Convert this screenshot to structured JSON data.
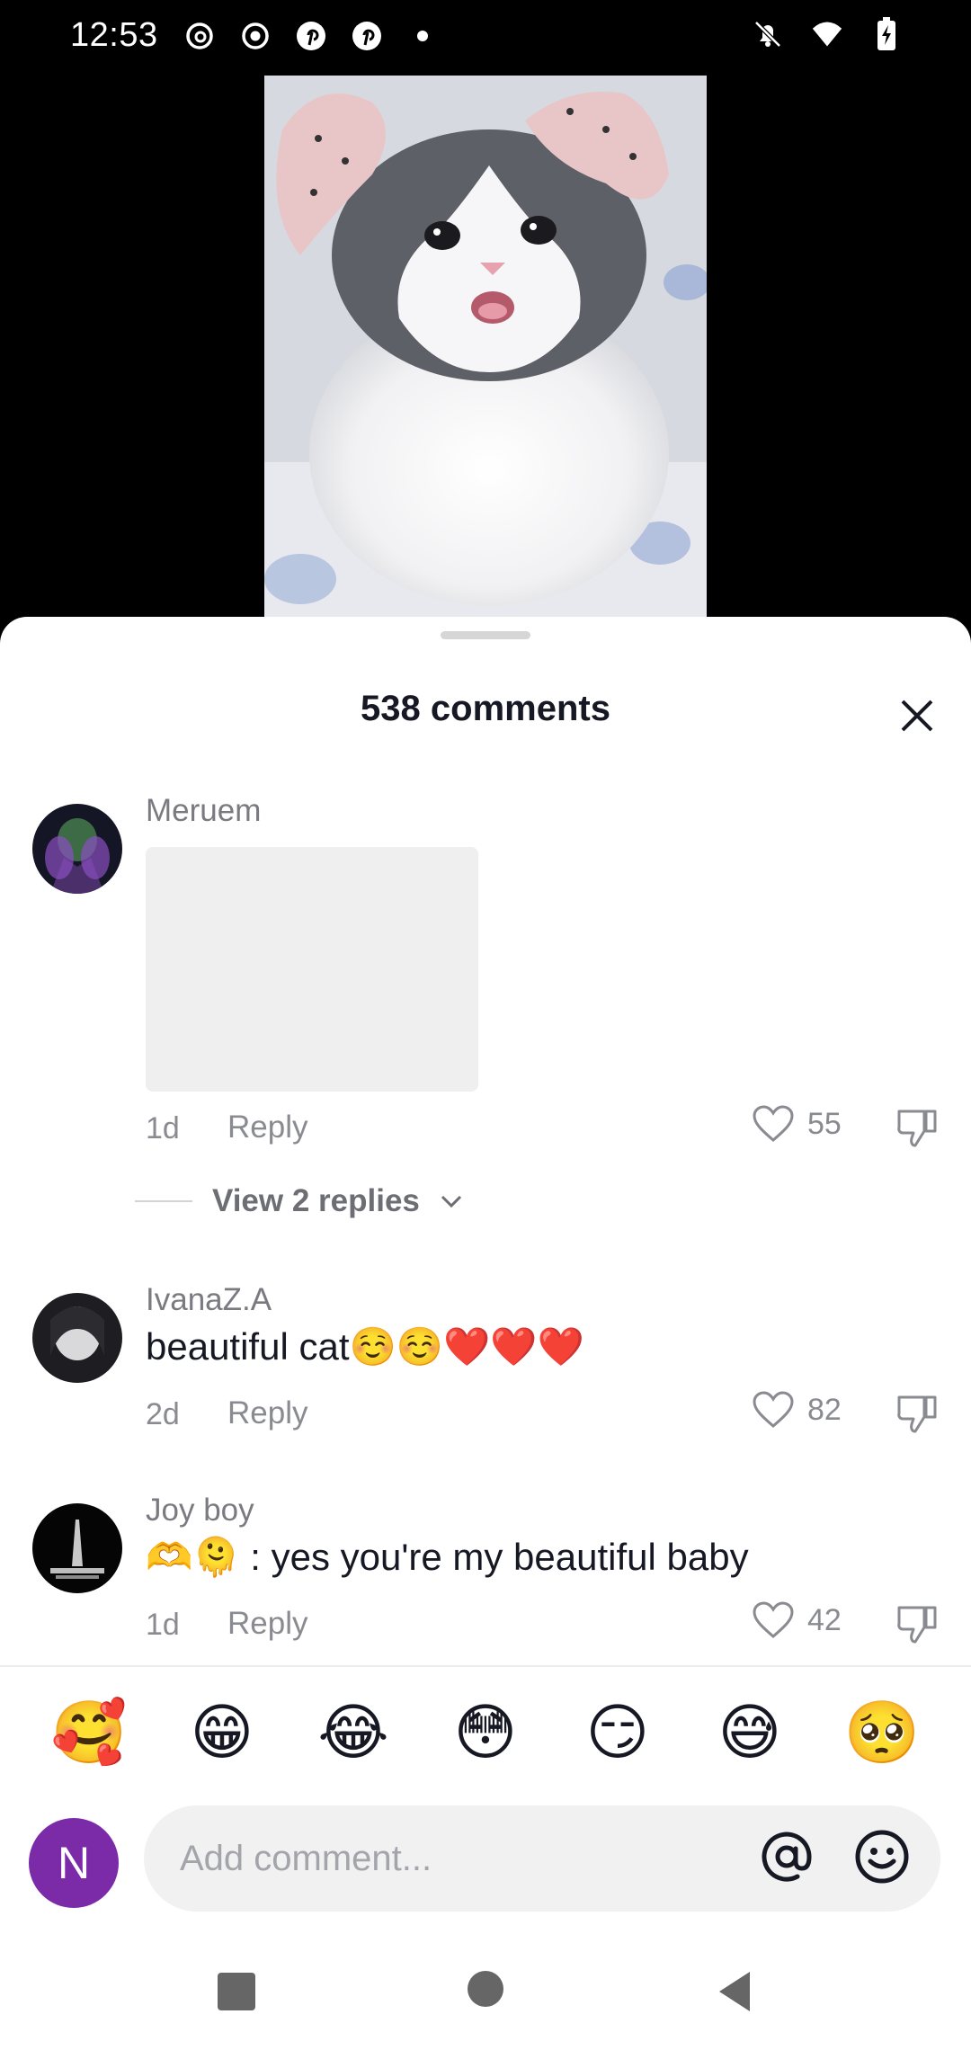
{
  "status_bar": {
    "time": "12:53",
    "left_icons": [
      "threads-icon",
      "record-icon",
      "pinterest-icon",
      "pinterest-icon",
      "dot-icon"
    ],
    "right_icons": [
      "bell-off-icon",
      "wifi-icon",
      "battery-charging-icon"
    ]
  },
  "sheet": {
    "title": "538 comments"
  },
  "comments": [
    {
      "username": "Meruem",
      "text": "",
      "time": "1d",
      "reply_label": "Reply",
      "likes": "55",
      "view_replies_label": "View 2 replies"
    },
    {
      "username": "IvanaZ.A",
      "text": "beautiful cat☺️☺️❤️❤️❤️",
      "time": "2d",
      "reply_label": "Reply",
      "likes": "82"
    },
    {
      "username": "Joy boy",
      "text": "🫶🫠 : yes you're my beautiful baby",
      "time": "1d",
      "reply_label": "Reply",
      "likes": "42"
    }
  ],
  "emoji_bar": [
    "🥰",
    "😁",
    "😂",
    "😳",
    "😏",
    "😅",
    "🥺"
  ],
  "input": {
    "avatar_letter": "N",
    "placeholder": "Add comment..."
  },
  "colors": {
    "user_avatar": "#7b2aa8",
    "sheet_bg": "#ffffff",
    "input_bg": "#f1f1f2"
  }
}
